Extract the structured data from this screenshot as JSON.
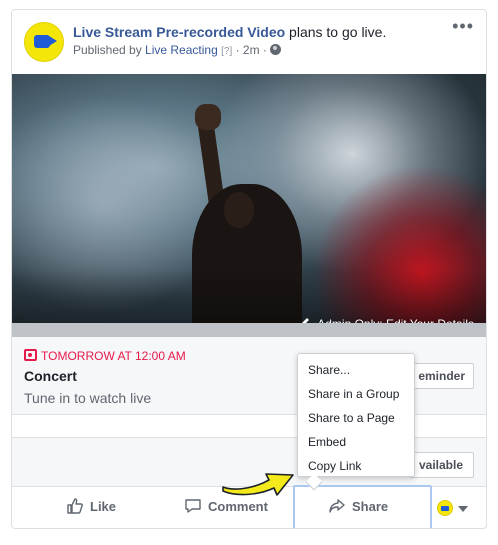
{
  "post": {
    "page_name": "Live Stream Pre-recorded Video",
    "action_text": " plans to go live.",
    "published_by_prefix": "Published by ",
    "published_by": "Live Reacting",
    "help_mark": "[?]",
    "dot": " · ",
    "time": "2m",
    "dot2": " · ",
    "avatar_text": "LIVE Streaming"
  },
  "media": {
    "admin_label": "Admin Only: Edit Your Details"
  },
  "event": {
    "when": "TOMORROW AT 12:00 AM",
    "name": "Concert",
    "description": "Tune in to watch live",
    "reminder_button": "eminder",
    "available_button": "vailable"
  },
  "share_menu": {
    "items": [
      "Share...",
      "Share in a Group",
      "Share to a Page",
      "Embed",
      "Copy Link"
    ]
  },
  "actions": {
    "like": "Like",
    "comment": "Comment",
    "share": "Share"
  },
  "colors": {
    "link": "#385898",
    "accent_red": "#e6194b",
    "share_highlight": "#a9c7ef",
    "arrow_yellow": "#f4ea1b"
  }
}
